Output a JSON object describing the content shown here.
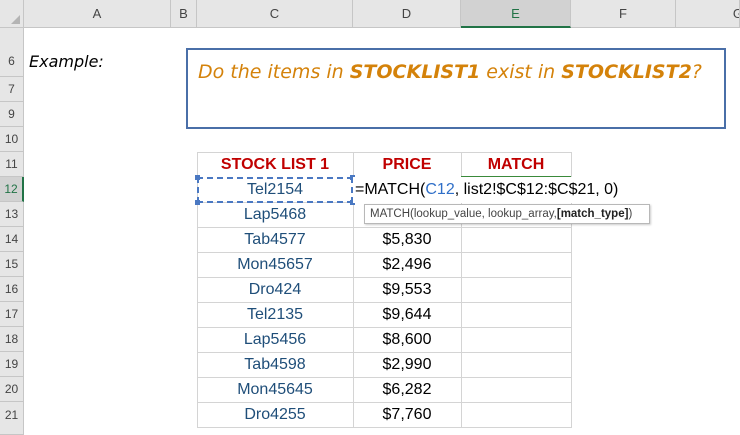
{
  "columns": [
    "A",
    "B",
    "C",
    "D",
    "E",
    "F",
    "G"
  ],
  "rows": [
    "6",
    "7",
    "9",
    "10",
    "11",
    "12",
    "13",
    "14",
    "15",
    "16",
    "17",
    "18",
    "19",
    "20",
    "21"
  ],
  "example_label": "Example:",
  "callout": {
    "prefix": "Do the items in ",
    "list1": "STOCKLIST1",
    "middle": " exist in ",
    "list2": "STOCKLIST2",
    "suffix": "?"
  },
  "table": {
    "headers": [
      "STOCK LIST 1",
      "PRICE",
      "MATCH"
    ],
    "items": [
      "Tel2154",
      "Lap5468",
      "Tab4577",
      "Mon45657",
      "Dro424",
      "Tel2135",
      "Lap5456",
      "Tab4598",
      "Mon45645",
      "Dro4255"
    ],
    "prices": [
      "",
      "",
      "$5,830",
      "$2,496",
      "$9,553",
      "$9,644",
      "$8,600",
      "$2,990",
      "$6,282",
      "$7,760"
    ]
  },
  "formula": {
    "start": "=MATCH(",
    "ref": "C12",
    "rest": ", list2!$C$12:$C$21, 0)"
  },
  "tooltip": {
    "func": "MATCH(lookup_value, lookup_array, ",
    "bold_arg": "[match_type]",
    "close": ")"
  },
  "colors": {
    "header_red": "#c00000",
    "item_blue": "#1f4e79",
    "callout_orange": "#d4820a",
    "callout_border": "#4a6fa8",
    "excel_green": "#217346"
  }
}
